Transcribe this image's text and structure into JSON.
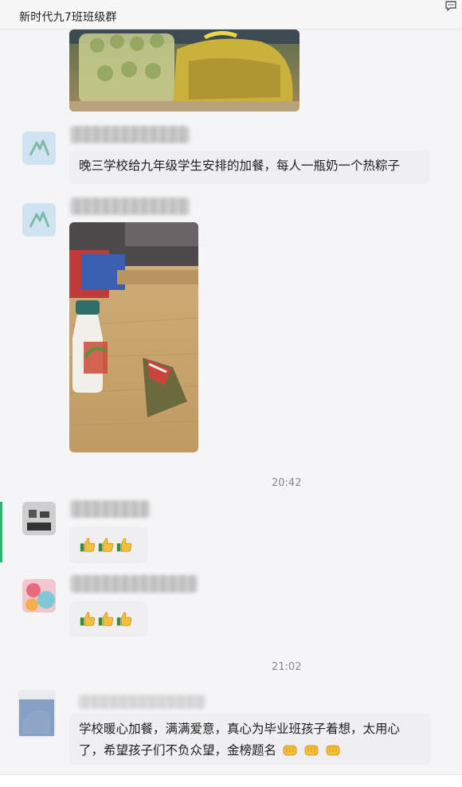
{
  "window": {
    "group_title": "新时代九7班班级群",
    "top_icon": "chat-bubble-icon"
  },
  "messages": [
    {
      "type": "image",
      "content": "photo of bagged drinks and packages"
    },
    {
      "type": "text",
      "text": "晚三学校给九年级学生安排的加餐，每人一瓶奶一个热粽子"
    },
    {
      "type": "image",
      "content": "photo of a milk bottle and a zongzi on a table"
    },
    {
      "type": "timestamp",
      "text": "20:42"
    },
    {
      "type": "emoji",
      "emoji": "thumbs-up",
      "count": 3
    },
    {
      "type": "emoji",
      "emoji": "thumbs-up",
      "count": 3
    },
    {
      "type": "timestamp",
      "text": "21:02"
    },
    {
      "type": "text",
      "text_line1": "学校暖心加餐，满满爱意，真心为毕业班孩子着想，太用心",
      "text_line2": "了，希望孩子们不负众望，金榜题名",
      "trailing_emoji": "fist-bump",
      "trailing_emoji_count": 3
    }
  ],
  "colors": {
    "background": "#f5f5f7",
    "bubble": "#efeff2",
    "accent": "#2db36b",
    "timestamp": "#8a8a8a"
  }
}
